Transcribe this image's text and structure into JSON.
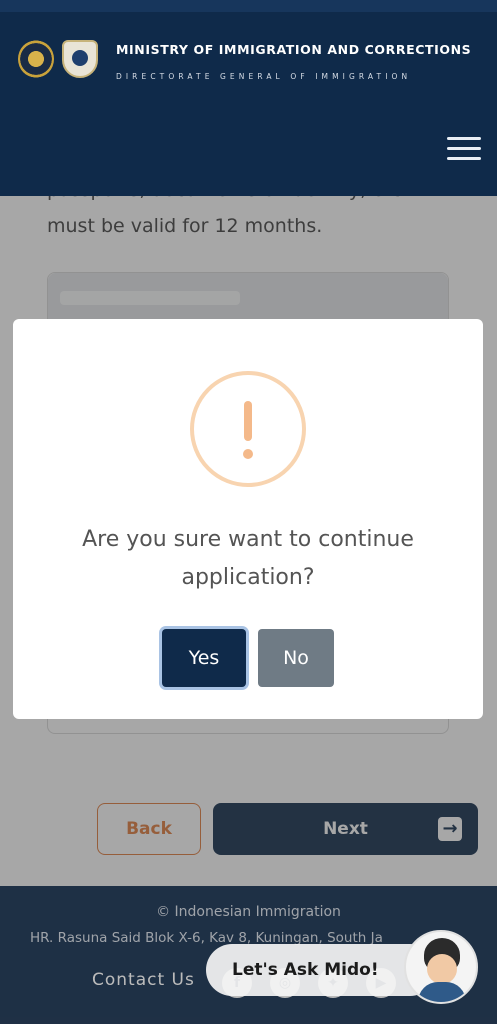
{
  "header": {
    "org_title": "MINISTRY OF IMMIGRATION AND CORRECTIONS",
    "org_subtitle": "DIRECTORATE GENERAL OF IMMIGRATION"
  },
  "content": {
    "partial_line": "passports, documents of identity, etc.",
    "body_line": "must be valid for 12 months."
  },
  "nav": {
    "back_label": "Back",
    "next_label": "Next"
  },
  "modal": {
    "question": "Are you sure want to continue application?",
    "yes_label": "Yes",
    "no_label": "No"
  },
  "footer": {
    "copyright": "© Indonesian Immigration",
    "address": "HR. Rasuna Said Blok X-6, Kav 8, Kuningan, South Ja",
    "contact_label": "Contact Us"
  },
  "chatbot": {
    "label": "Let's Ask Mido!"
  },
  "colors": {
    "brand_navy": "#0f2a4a",
    "accent_orange": "#e07a3b",
    "warning_orange": "#f4b98a"
  }
}
